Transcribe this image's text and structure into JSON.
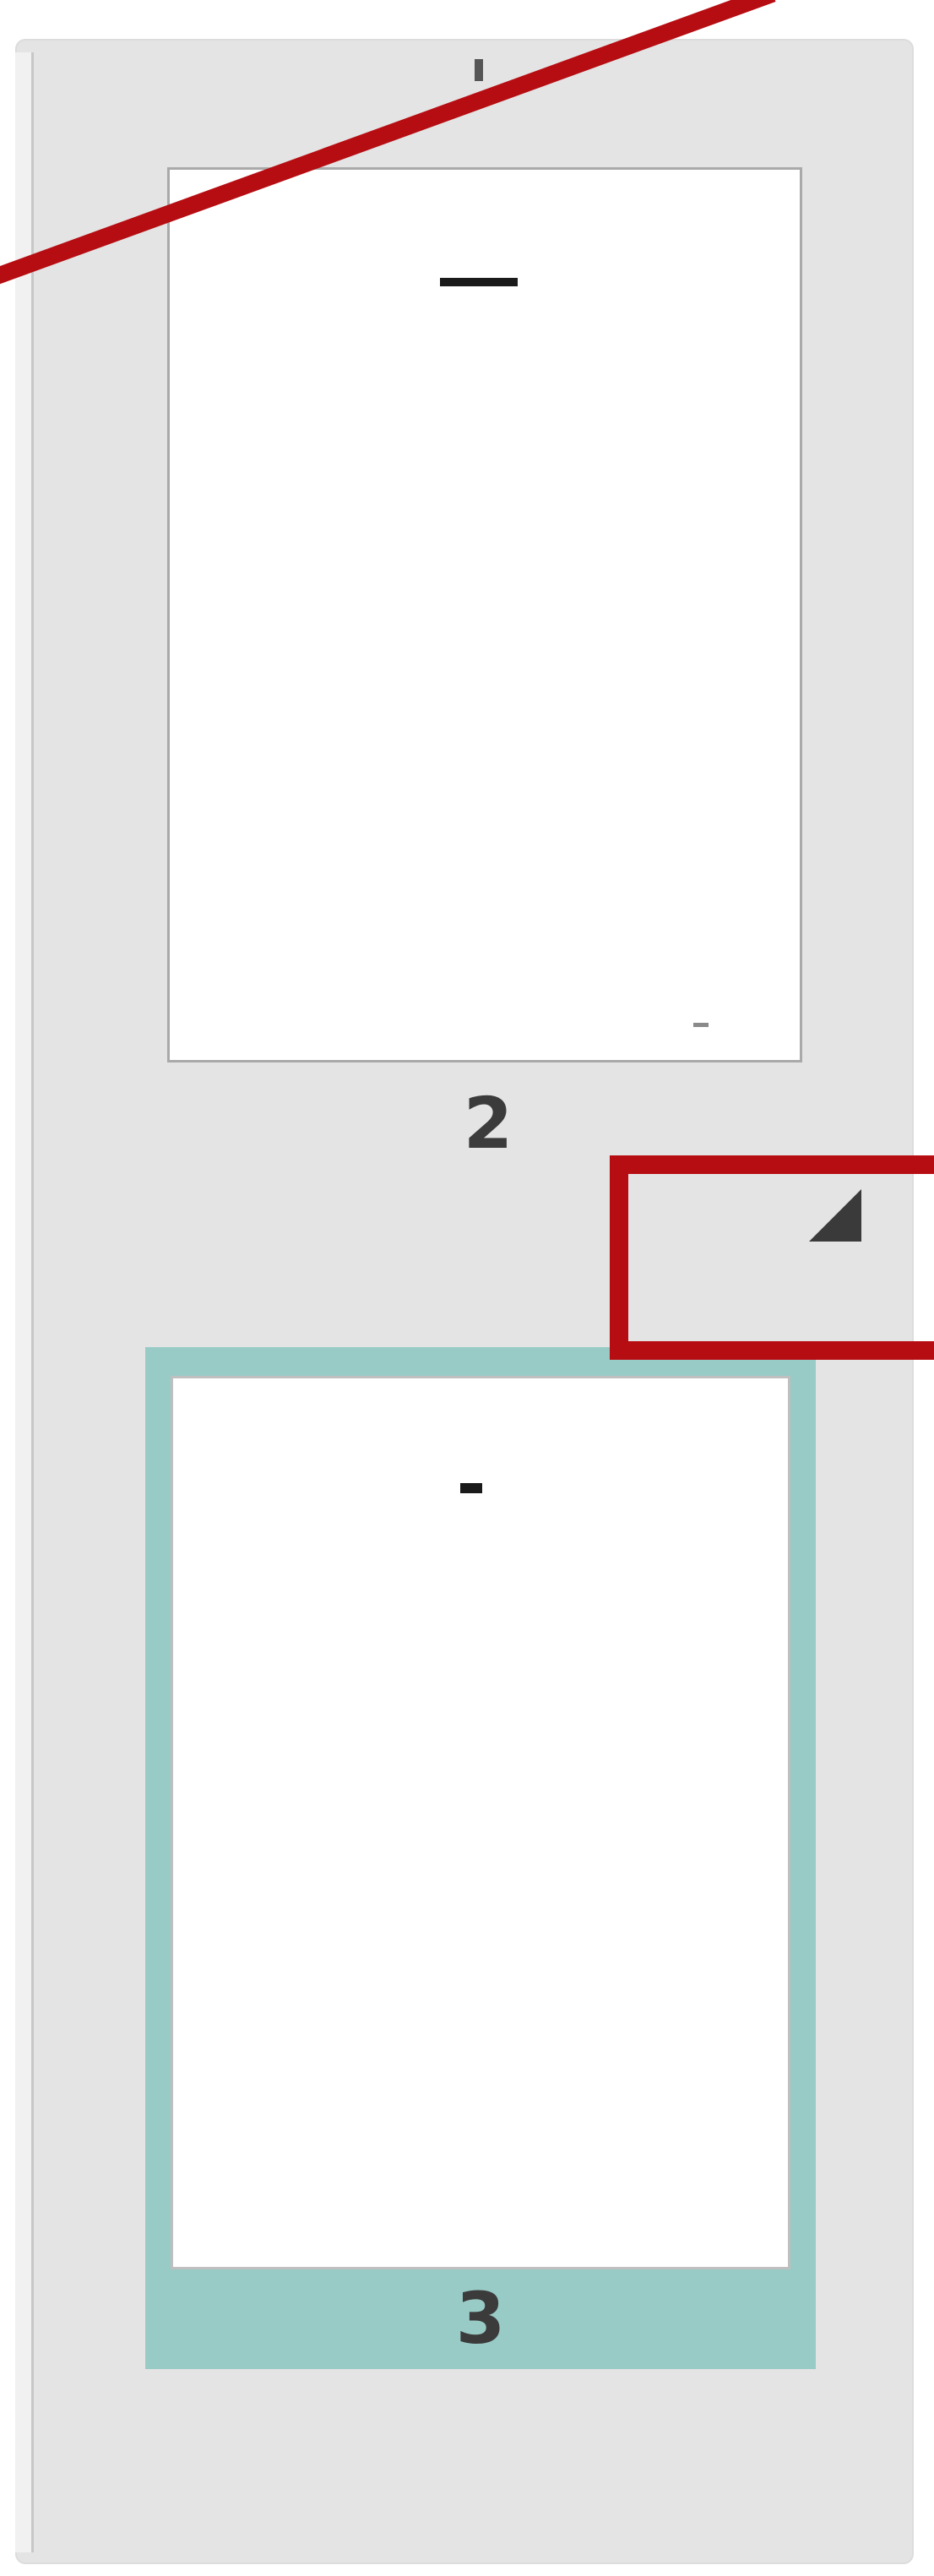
{
  "panel": {
    "name": "page-thumbnails-panel"
  },
  "pages": [
    {
      "number": "2",
      "selected": false
    },
    {
      "number": "3",
      "selected": true
    }
  ],
  "colors": {
    "panel_bg": "#e4e4e4",
    "selected_frame": "#99cbc6",
    "annotation_red": "#b60d12",
    "page_number_text": "#3b3b3b"
  },
  "icons": {
    "context_menu_arrow": "corner-triangle-icon"
  }
}
